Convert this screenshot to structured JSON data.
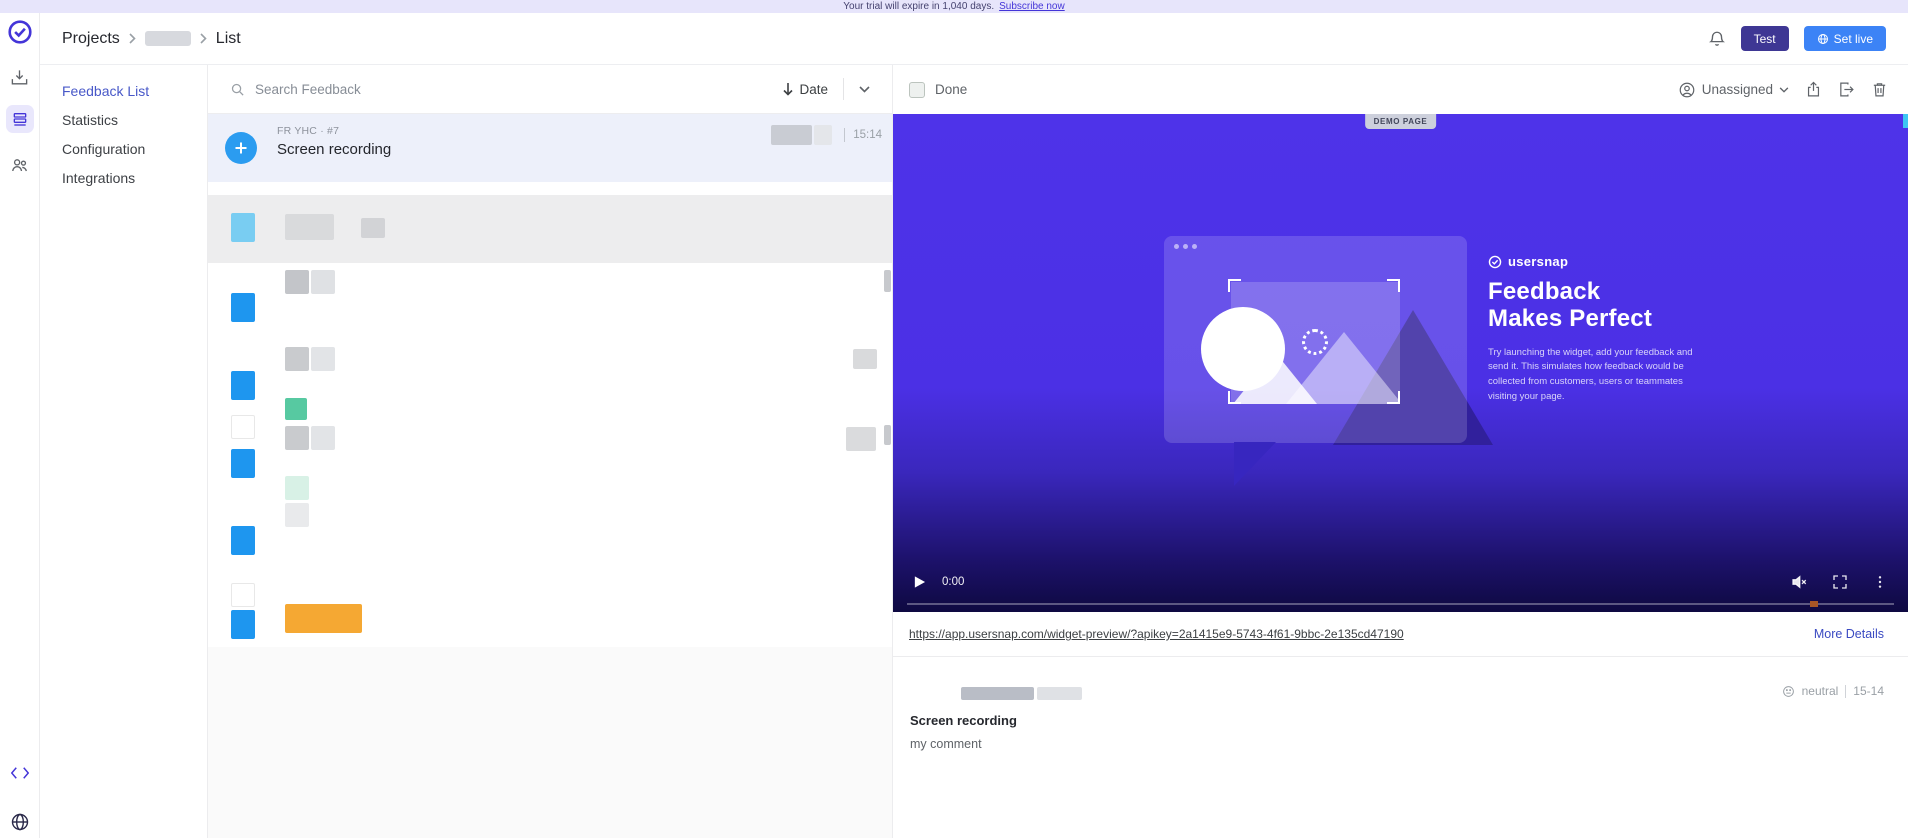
{
  "colors": {
    "accent_indigo": "#4435d8",
    "test_button_bg": "#3e3794",
    "set_live_bg": "#3c83f6",
    "video_purple": "#4c31e8",
    "selected_item_bg": "#edf0fa",
    "item_icon_blue": "#2b9cf0",
    "skeleton_orange": "#f5a833",
    "skeleton_teal": "#57c9a1"
  },
  "banner": {
    "text": "Your trial will expire in 1,040 days.",
    "link_label": "Subscribe now"
  },
  "header": {
    "breadcrumb": {
      "projects": "Projects",
      "current": "List"
    },
    "test_button": "Test",
    "set_live_button": "Set live"
  },
  "sidebar_nav": {
    "items": [
      "Feedback List",
      "Statistics",
      "Configuration",
      "Integrations"
    ]
  },
  "feedback_list": {
    "search_placeholder": "Search Feedback",
    "sort_label": "Date",
    "selected_item": {
      "meta": "FR YHC · #7",
      "title": "Screen recording",
      "time": "15:14"
    }
  },
  "detail": {
    "done_label": "Done",
    "assignee_label": "Unassigned",
    "video": {
      "demo_tag": "DEMO PAGE",
      "brand": "usersnap",
      "headline": [
        "Feedback",
        "Makes Perfect"
      ],
      "body": "Try launching the widget, add your feedback and send it. This simulates how feedback would be collected from customers, users or teammates visiting your page.",
      "current_time": "0:00"
    },
    "widget_link": "https://app.usersnap.com/widget-preview/?apikey=2a1415e9-5743-4f61-9bbc-2e135cd47190",
    "more_details_label": "More Details",
    "comment": {
      "sentiment": "neutral",
      "time": "15-14",
      "title": "Screen recording",
      "body": "my comment"
    }
  }
}
